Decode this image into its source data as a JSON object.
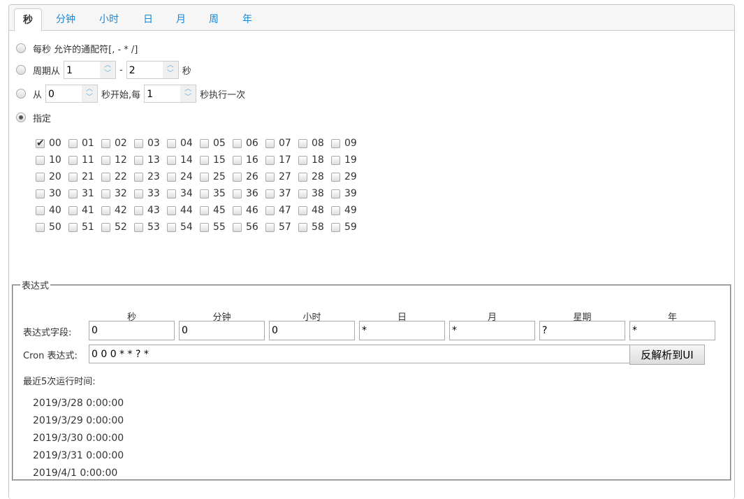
{
  "tabs": [
    "秒",
    "分钟",
    "小时",
    "日",
    "月",
    "周",
    "年"
  ],
  "active_tab": "秒",
  "options": {
    "every": {
      "label": "每秒 允许的通配符[, - * /]",
      "selected": false
    },
    "period": {
      "label": "周期从",
      "from": "1",
      "sep": "-",
      "to": "2",
      "unit": "秒",
      "selected": false
    },
    "start": {
      "label": "从",
      "from": "0",
      "mid": "秒开始,每",
      "every": "1",
      "unit": "秒执行一次",
      "selected": false
    },
    "specify": {
      "label": "指定",
      "selected": true
    }
  },
  "seconds": [
    "00",
    "01",
    "02",
    "03",
    "04",
    "05",
    "06",
    "07",
    "08",
    "09",
    "10",
    "11",
    "12",
    "13",
    "14",
    "15",
    "16",
    "17",
    "18",
    "19",
    "20",
    "21",
    "22",
    "23",
    "24",
    "25",
    "26",
    "27",
    "28",
    "29",
    "30",
    "31",
    "32",
    "33",
    "34",
    "35",
    "36",
    "37",
    "38",
    "39",
    "40",
    "41",
    "42",
    "43",
    "44",
    "45",
    "46",
    "47",
    "48",
    "49",
    "50",
    "51",
    "52",
    "53",
    "54",
    "55",
    "56",
    "57",
    "58",
    "59"
  ],
  "checked_seconds": [
    "00"
  ],
  "expression": {
    "legend": "表达式",
    "headers": [
      "秒",
      "分钟",
      "小时",
      "日",
      "月",
      "星期",
      "年"
    ],
    "fields_label": "表达式字段:",
    "fields": [
      "0",
      "0",
      "0",
      "*",
      "*",
      "?",
      "*"
    ],
    "cron_label": "Cron 表达式:",
    "cron": "0 0 0 * * ? *",
    "parse_button": "反解析到UI",
    "recent_label": "最近5次运行时间:",
    "recent": [
      "2019/3/28 0:00:00",
      "2019/3/29 0:00:00",
      "2019/3/30 0:00:00",
      "2019/3/31 0:00:00",
      "2019/4/1 0:00:00"
    ]
  }
}
